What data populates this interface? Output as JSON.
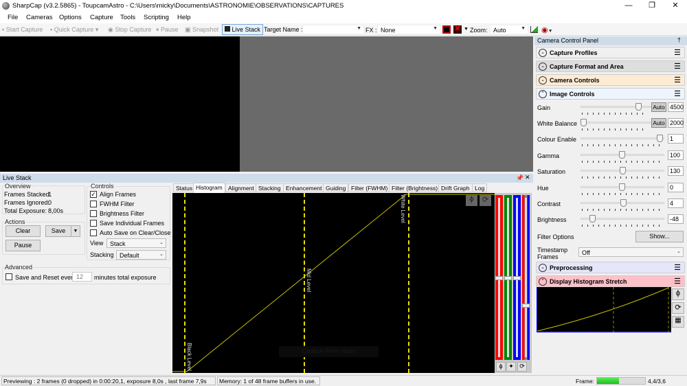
{
  "window": {
    "title": "SharpCap (v3.2.5865) - ToupcamAstro - C:\\Users\\micky\\Documents\\ASTRONOMIE\\OBSERVATIONS\\CAPTURES"
  },
  "menu": [
    "File",
    "Cameras",
    "Options",
    "Capture",
    "Tools",
    "Scripting",
    "Help"
  ],
  "toolbar": {
    "start_capture": "Start Capture",
    "quick_capture": "Quick Capture",
    "stop_capture": "Stop Capture",
    "pause": "Pause",
    "snapshot": "Snapshot",
    "live_stack": "Live Stack",
    "target_name_label": "Target Name :",
    "target_name_value": "",
    "fx_label": "FX :",
    "fx_value": "None",
    "zoom_label": "Zoom:",
    "zoom_value": "Auto"
  },
  "live_stack": {
    "title": "Live Stack",
    "overview": {
      "label": "Overview",
      "frames_stacked_label": "Frames Stacked:",
      "frames_stacked": "1",
      "frames_ignored_label": "Frames Ignored:",
      "frames_ignored": "0",
      "total_exposure_label": "Total Exposure:",
      "total_exposure": "8,00s"
    },
    "actions": {
      "label": "Actions",
      "clear": "Clear",
      "save": "Save",
      "pause": "Pause"
    },
    "controls": {
      "label": "Controls",
      "checkboxes": [
        {
          "label": "Align Frames",
          "checked": true
        },
        {
          "label": "FWHM Filter",
          "checked": false
        },
        {
          "label": "Brightness Filter",
          "checked": false
        },
        {
          "label": "Save Individual Frames",
          "checked": false
        },
        {
          "label": "Auto Save on Clear/Close",
          "checked": false
        }
      ],
      "view_label": "View",
      "view_value": "Stack",
      "stacking_label": "Stacking",
      "stacking_value": "Default"
    },
    "advanced": {
      "label": "Advanced",
      "save_reset_label": "Save and Reset every",
      "minutes": "12",
      "suffix": "minutes total exposure",
      "checked": false
    },
    "tabs": [
      "Status",
      "Histogram",
      "Alignment",
      "Stacking",
      "Enhancement",
      "Guiding",
      "Filter (FWHM)",
      "Filter (Brightness)",
      "Drift Graph",
      "Log"
    ],
    "active_tab": "Histogram",
    "histogram": {
      "black_level": "Black Level",
      "mid_level": "Mid Level",
      "white_level": "White Level",
      "tooltip": "Capture Plein écran"
    }
  },
  "camera_control_panel": {
    "title": "Camera Control Panel",
    "sections": [
      "Capture Profiles",
      "Capture Format and Area",
      "Camera Controls",
      "Image Controls"
    ],
    "image_controls": [
      {
        "label": "Gain",
        "value": "4500",
        "auto": "Auto",
        "position": 0.93
      },
      {
        "label": "White Balance",
        "value": "2000",
        "auto": "Auto",
        "position": 0.0
      },
      {
        "label": "Colour Enable",
        "value": "1",
        "position": 1.0
      },
      {
        "label": "Gamma",
        "value": "100",
        "position": 0.5
      },
      {
        "label": "Saturation",
        "value": "130",
        "position": 0.51
      },
      {
        "label": "Hue",
        "value": "0",
        "position": 0.5
      },
      {
        "label": "Contrast",
        "value": "4",
        "position": 0.52
      },
      {
        "label": "Brightness",
        "value": "-48",
        "position": 0.12
      }
    ],
    "filter_options_label": "Filter Options",
    "filter_options_button": "Show...",
    "timestamp_label": "Timestamp Frames",
    "timestamp_value": "Off",
    "preprocessing": "Preprocessing",
    "display_histogram_stretch": "Display Histogram Stretch"
  },
  "status": {
    "preview": "Previewing : 2 frames (0 dropped) in 0:00:20,1, exposure 8,0s , last frame 7,9s",
    "memory": "Memory: 1 of 48 frame buffers in use.",
    "frame_label": "Frame:",
    "frame_progress": 0.45,
    "frame_value": "4,4/3,6"
  },
  "colors": {
    "accent_header": "#cfdcea",
    "camera_controls_bg": "#fdebd3",
    "image_controls_bg": "#eef5fd",
    "preprocessing_bg": "#e6e6fa",
    "stretch_bg": "#ffc0c8",
    "curve": "#c8c000",
    "level_line": "#e8e000"
  }
}
